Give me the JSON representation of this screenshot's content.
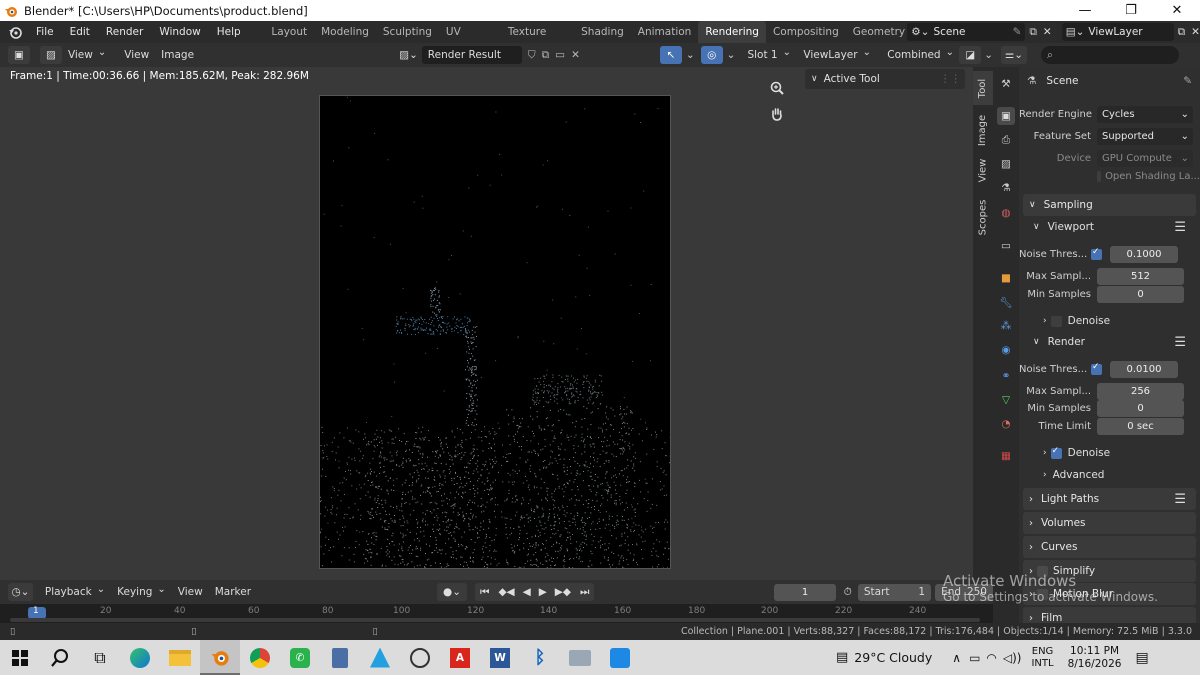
{
  "window": {
    "title": "Blender* [C:\\Users\\HP\\Documents\\product.blend]",
    "min": "—",
    "max": "❐",
    "close": "✕"
  },
  "menu": [
    "File",
    "Edit",
    "Render",
    "Window",
    "Help"
  ],
  "workspaces": [
    "Layout",
    "Modeling",
    "Sculpting",
    "UV Editing",
    "Texture Paint",
    "Shading",
    "Animation",
    "Rendering",
    "Compositing",
    "Geometry Noc"
  ],
  "active_workspace": "Rendering",
  "scene": "Scene",
  "view_layer": "ViewLayer",
  "image_editor": {
    "header_menus": [
      "View",
      "View",
      "Image"
    ],
    "image_name": "Render Result",
    "slot": "Slot 1",
    "view_layer": "ViewLayer",
    "pass": "Combined"
  },
  "viewport": {
    "frame_info": "Frame:1 | Time:00:36.66 | Mem:185.62M, Peak: 282.96M",
    "active_tool_label": "Active Tool"
  },
  "side_tabs": [
    "Tool",
    "Image",
    "View",
    "Scopes"
  ],
  "properties": {
    "scene_label": "Scene",
    "render_engine_label": "Render Engine",
    "render_engine": "Cycles",
    "feature_set_label": "Feature Set",
    "feature_set": "Supported",
    "device_label": "Device",
    "device": "GPU Compute",
    "open_shading": "Open Shading La...",
    "sampling": "Sampling",
    "viewport": "Viewport",
    "vp_noise_label": "Noise Thres...",
    "vp_noise": "0.1000",
    "vp_max_label": "Max Sampl...",
    "vp_max": "512",
    "vp_min_label": "Min Samples",
    "vp_min": "0",
    "denoise": "Denoise",
    "render": "Render",
    "r_noise_label": "Noise Thres...",
    "r_noise": "0.0100",
    "r_max_label": "Max Sampl...",
    "r_max": "256",
    "r_min_label": "Min Samples",
    "r_min": "0",
    "time_limit_label": "Time Limit",
    "time_limit": "0 sec",
    "r_denoise": "Denoise",
    "advanced": "Advanced",
    "light_paths": "Light Paths",
    "volumes": "Volumes",
    "curves": "Curves",
    "simplify": "Simplify",
    "motion_blur": "Motion Blur",
    "film": "Film"
  },
  "timeline": {
    "menus": [
      "Playback",
      "Keying",
      "View",
      "Marker"
    ],
    "current_frame": "1",
    "start_label": "Start",
    "start": "1",
    "end_label": "End",
    "end": "250",
    "ticks": [
      "1",
      "20",
      "40",
      "60",
      "80",
      "100",
      "120",
      "140",
      "160",
      "180",
      "200",
      "220",
      "240"
    ]
  },
  "statusbar": {
    "info": "Collection | Plane.001 | Verts:88,327 | Faces:88,172 | Tris:176,484 | Objects:1/14 | Memory: 72.5 MiB | 3.3.0"
  },
  "watermark": {
    "line1": "Activate Windows",
    "line2": "Go to Settings to activate Windows."
  },
  "taskbar": {
    "weather": "29°C  Cloudy",
    "lang1": "ENG",
    "lang2": "INTL",
    "time": "10:11 PM",
    "date": "8/16/2026"
  },
  "colors": {
    "accent": "#4772b3",
    "panel": "#303030",
    "viewport_bg": "#393939"
  }
}
